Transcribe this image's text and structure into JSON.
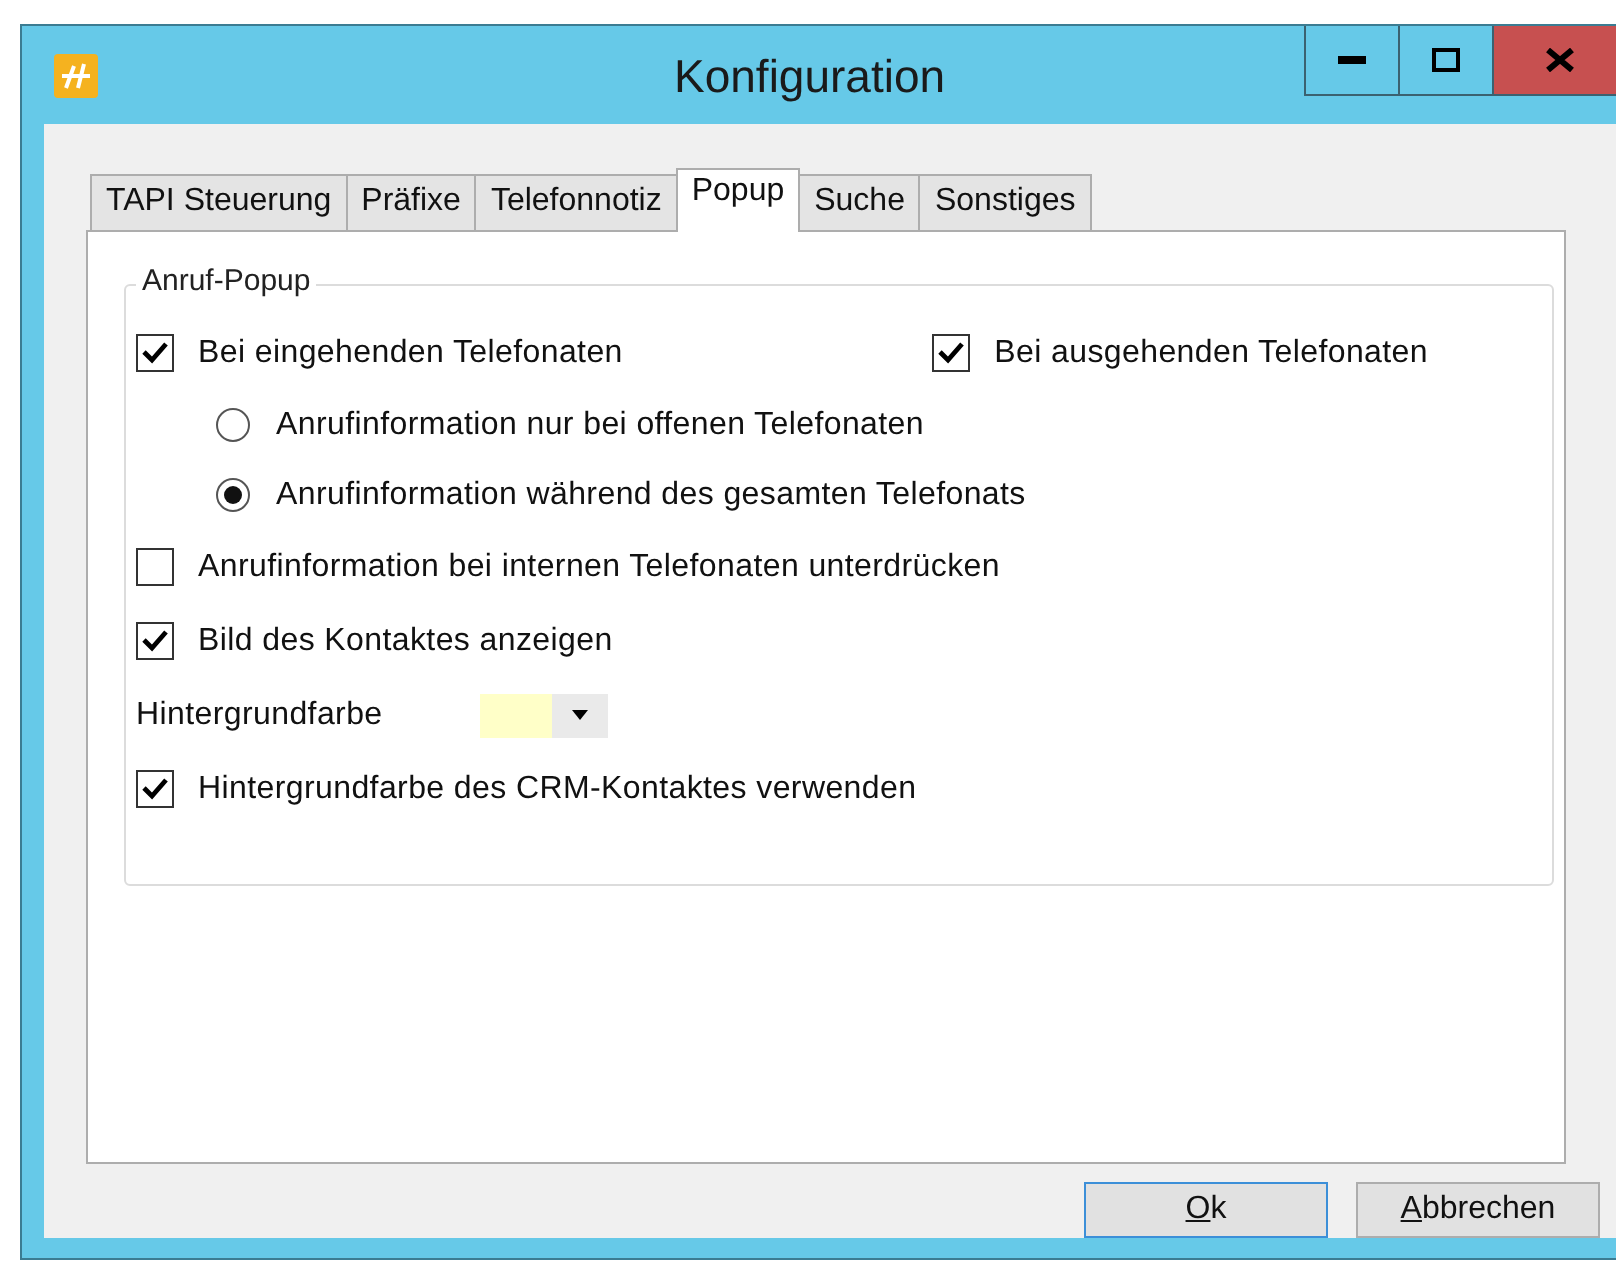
{
  "window": {
    "title": "Konfiguration"
  },
  "tabs": [
    {
      "label": "TAPI Steuerung",
      "selected": false
    },
    {
      "label": "Präfixe",
      "selected": false
    },
    {
      "label": "Telefonnotiz",
      "selected": false
    },
    {
      "label": "Popup",
      "selected": true
    },
    {
      "label": "Suche",
      "selected": false
    },
    {
      "label": "Sonstiges",
      "selected": false
    }
  ],
  "group": {
    "title": "Anruf-Popup",
    "rows": [
      {
        "items": [
          {
            "kind": "checkbox",
            "label": "Bei eingehenden Telefonaten",
            "checked": true
          },
          {
            "kind": "checkbox",
            "label": "Bei ausgehenden Telefonaten",
            "checked": true
          }
        ]
      },
      {
        "items": [
          {
            "kind": "radio",
            "label": "Anrufinformation nur bei offenen Telefonaten",
            "selected": false
          }
        ]
      },
      {
        "items": [
          {
            "kind": "radio",
            "label": "Anrufinformation während des gesamten Telefonats",
            "selected": true
          }
        ]
      },
      {
        "items": [
          {
            "kind": "checkbox",
            "label": "Anrufinformation bei internen Telefonaten unterdrücken",
            "checked": false
          }
        ]
      },
      {
        "items": [
          {
            "kind": "checkbox",
            "label": "Bild des Kontaktes anzeigen",
            "checked": true
          }
        ]
      },
      {
        "items": [
          {
            "kind": "color",
            "label": "Hintergrundfarbe",
            "color": "#ffffc8"
          }
        ]
      },
      {
        "items": [
          {
            "kind": "checkbox",
            "label": "Hintergrundfarbe des CRM-Kontaktes verwenden",
            "checked": true
          }
        ]
      }
    ]
  },
  "buttons": [
    {
      "label": "Ok",
      "default": true
    },
    {
      "label": "Abbrechen",
      "default": false
    }
  ]
}
